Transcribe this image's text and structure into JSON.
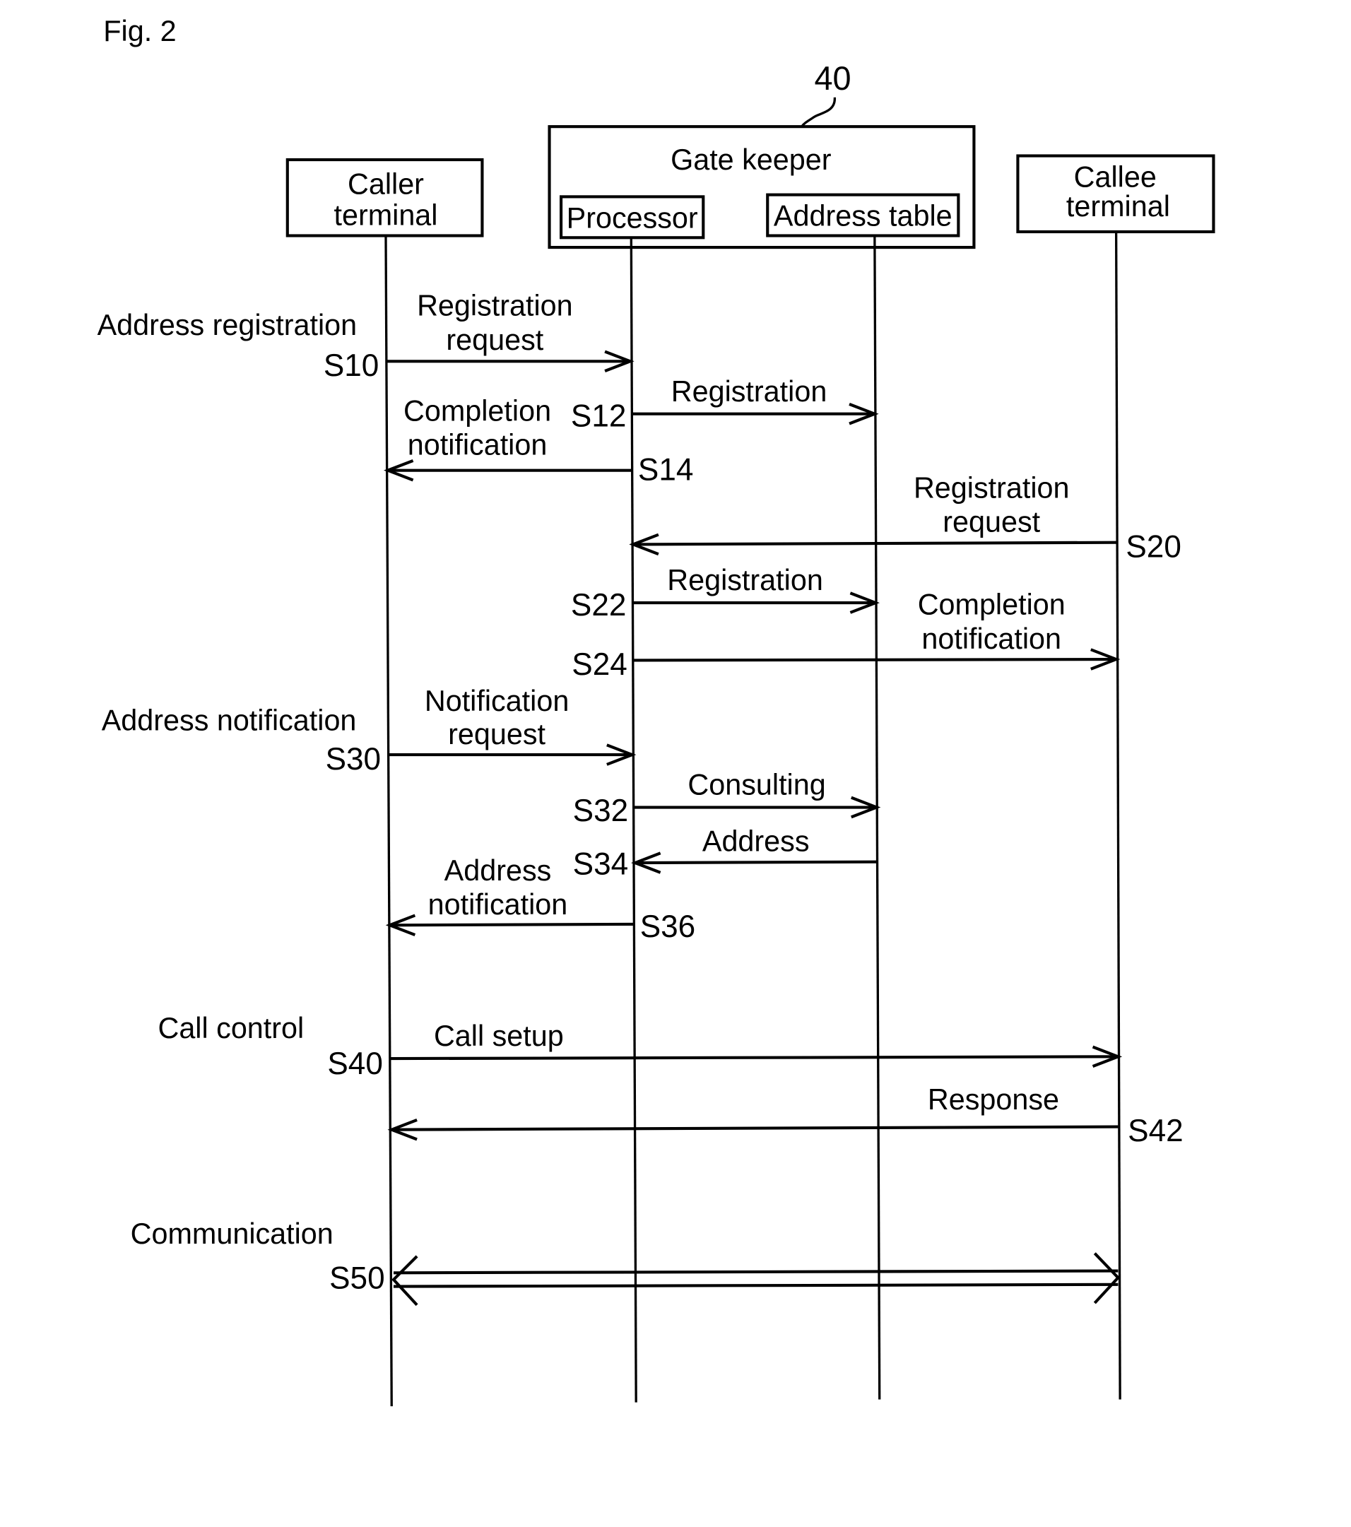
{
  "figure": {
    "label": "Fig. 2",
    "reference_numeral": "40"
  },
  "participants": [
    {
      "id": "caller",
      "name": "Caller terminal",
      "lines": [
        "Caller",
        "terminal"
      ]
    },
    {
      "id": "gatekeeper",
      "name": "Gate keeper",
      "lines": [
        "Gate keeper"
      ]
    },
    {
      "id": "processor",
      "name": "Processor",
      "lines": [
        "Processor"
      ]
    },
    {
      "id": "address_table",
      "name": "Address table",
      "lines": [
        "Address table"
      ]
    },
    {
      "id": "callee",
      "name": "Callee terminal",
      "lines": [
        "Callee",
        "terminal"
      ]
    }
  ],
  "phases": [
    {
      "label": "Address registration"
    },
    {
      "label": "Address notification"
    },
    {
      "label": "Call control"
    },
    {
      "label": "Communication"
    }
  ],
  "messages": [
    {
      "step": "S10",
      "from": "caller",
      "to": "processor",
      "lines": [
        "Registration",
        "request"
      ]
    },
    {
      "step": "S12",
      "from": "processor",
      "to": "address_table",
      "lines": [
        "Registration"
      ]
    },
    {
      "step": "S14",
      "from": "processor",
      "to": "caller",
      "lines": [
        "Completion",
        "notification"
      ]
    },
    {
      "step": "S20",
      "from": "callee",
      "to": "processor",
      "lines": [
        "Registration",
        "request"
      ]
    },
    {
      "step": "S22",
      "from": "processor",
      "to": "address_table",
      "lines": [
        "Registration"
      ]
    },
    {
      "step": "S24",
      "from": "processor",
      "to": "callee",
      "lines": [
        "Completion",
        "notification"
      ]
    },
    {
      "step": "S30",
      "from": "caller",
      "to": "processor",
      "lines": [
        "Notification",
        "request"
      ]
    },
    {
      "step": "S32",
      "from": "processor",
      "to": "address_table",
      "lines": [
        "Consulting"
      ]
    },
    {
      "step": "S34",
      "from": "address_table",
      "to": "processor",
      "lines": [
        "Address"
      ]
    },
    {
      "step": "S36",
      "from": "processor",
      "to": "caller",
      "lines": [
        "Address",
        "notification"
      ]
    },
    {
      "step": "S40",
      "from": "caller",
      "to": "callee",
      "lines": [
        "Call setup"
      ]
    },
    {
      "step": "S42",
      "from": "callee",
      "to": "caller",
      "lines": [
        "Response"
      ]
    },
    {
      "step": "S50",
      "from": "caller",
      "to": "callee",
      "bidirectional": true,
      "lines": []
    }
  ]
}
